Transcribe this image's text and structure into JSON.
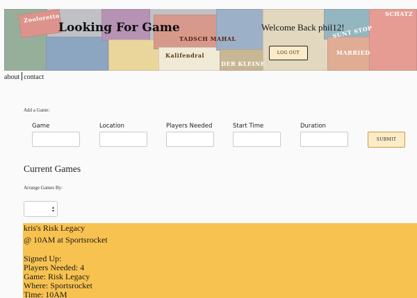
{
  "header": {
    "title": "Looking For Game",
    "welcome": "Welcome Back phil12!",
    "logout_label": "LOG OUT"
  },
  "nav": {
    "links": [
      "about",
      "contact"
    ]
  },
  "add_game": {
    "label": "Add a Game:",
    "fields": [
      {
        "label": "Game",
        "value": ""
      },
      {
        "label": "Location",
        "value": ""
      },
      {
        "label": "Players Needed",
        "value": ""
      },
      {
        "label": "Start Time",
        "value": ""
      },
      {
        "label": "Duration",
        "value": ""
      }
    ],
    "submit_label": "SUBMIT"
  },
  "current_games": {
    "title": "Current Games",
    "arrange_label": "Arrange Games By:",
    "arrange_value": "",
    "games": [
      {
        "heading": "kris's Risk Legacy",
        "subheading": "@ 10AM at Sportsrocket",
        "signed_up": "Signed Up:",
        "players_needed": "Players Needed: 4",
        "game": "Game: Risk Legacy",
        "where": "Where: Sportsrocket",
        "time": "Time: 10AM"
      }
    ]
  },
  "colors": {
    "card_bg": "#f7c250",
    "button_bg": "#fdebc8",
    "submit_border": "#c59b3e",
    "page_bg": "#fafafa"
  },
  "banner_box_text": [
    "Zooloretto",
    "TADSCH MAHAL",
    "Kalifendral",
    "DER KLEINE",
    "SCHATZ",
    "SUNT STOP",
    "MARRIED"
  ]
}
